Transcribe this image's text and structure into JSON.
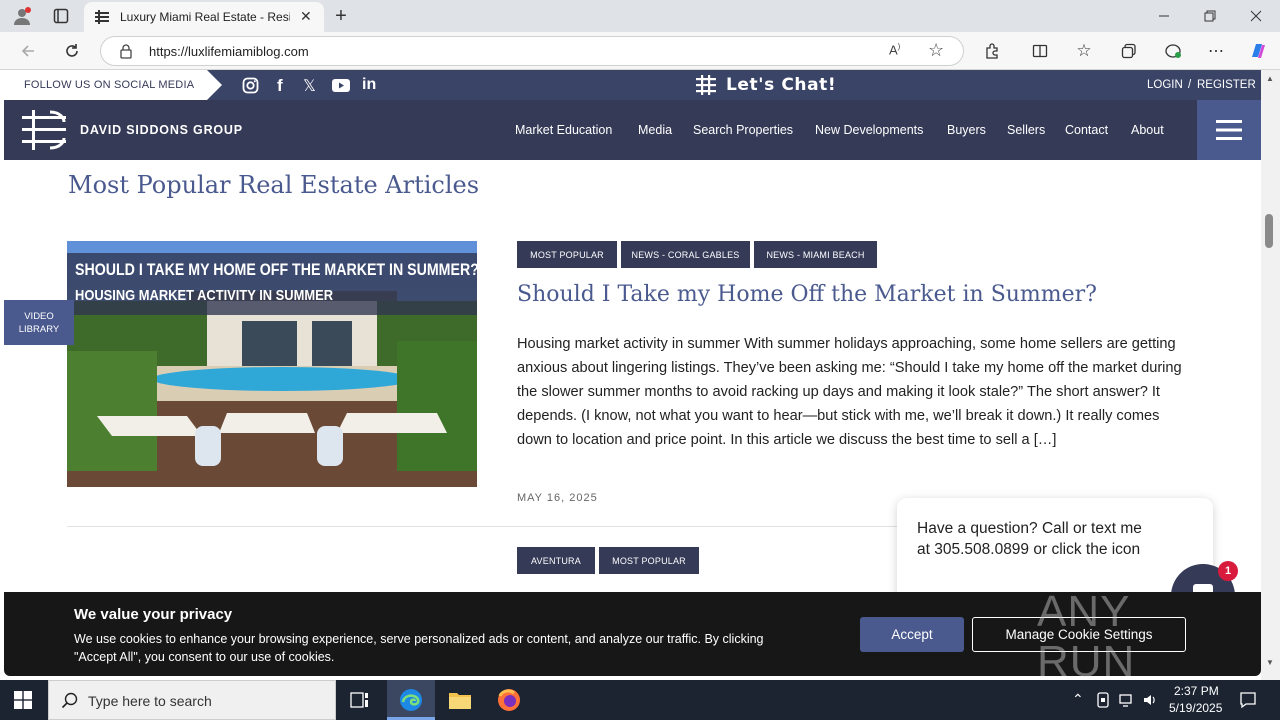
{
  "browser": {
    "tab_title": "Luxury Miami Real Estate - Resid",
    "url": "https://luxlifemiamiblog.com"
  },
  "site": {
    "follow_label": "FOLLOW US ON SOCIAL MEDIA",
    "chat_label": "Let's Chat!",
    "login": "LOGIN",
    "sep": "/",
    "register": "REGISTER",
    "brand": "DAVID SIDDONS GROUP",
    "nav": [
      "Market Education",
      "Media",
      "Search Properties",
      "New Developments",
      "Buyers",
      "Sellers",
      "Contact",
      "About"
    ],
    "video_library": "VIDEO LIBRARY"
  },
  "main": {
    "section_title": "Most Popular Real Estate Articles",
    "article1": {
      "tags": [
        "MOST POPULAR",
        "NEWS - CORAL GABLES",
        "NEWS - MIAMI BEACH"
      ],
      "image_line1": "SHOULD I TAKE MY HOME OFF THE MARKET IN SUMMER?",
      "image_line2": "HOUSING MARKET ACTIVITY IN SUMMER",
      "title": "Should I Take my Home Off the Market in Summer?",
      "excerpt": "Housing market activity in summer With summer holidays approaching, some home sellers are getting anxious about lingering listings. They’ve been asking me: “Should I take my home off the market during the slower summer months to avoid racking up days and making it look stale?” The short answer? It depends. (I know, not what you want to hear—but stick with me, we’ll break it down.) It really comes down to location and price point. In this article we discuss the best time to sell a […]",
      "date": "MAY 16, 2025"
    },
    "article2": {
      "tags": [
        "AVENTURA",
        "MOST POPULAR"
      ]
    }
  },
  "chat_popup": {
    "text": "Have a question? Call or text me at 305.508.0899 or click the icon",
    "badge": "1"
  },
  "cookie": {
    "title": "We value your privacy",
    "body": "We use cookies to enhance your browsing experience, serve personalized ads or content, and analyze our traffic. By clicking \"Accept All\", you consent to our use of cookies.",
    "accept": "Accept",
    "manage": "Manage Cookie Settings"
  },
  "watermark": "ANY RUN",
  "taskbar": {
    "search_placeholder": "Type here to search",
    "time": "2:37 PM",
    "date": "5/19/2025"
  },
  "colors": {
    "navy": "#353a57",
    "accent": "#4a5a8f",
    "tag_bg": "#353a57"
  }
}
